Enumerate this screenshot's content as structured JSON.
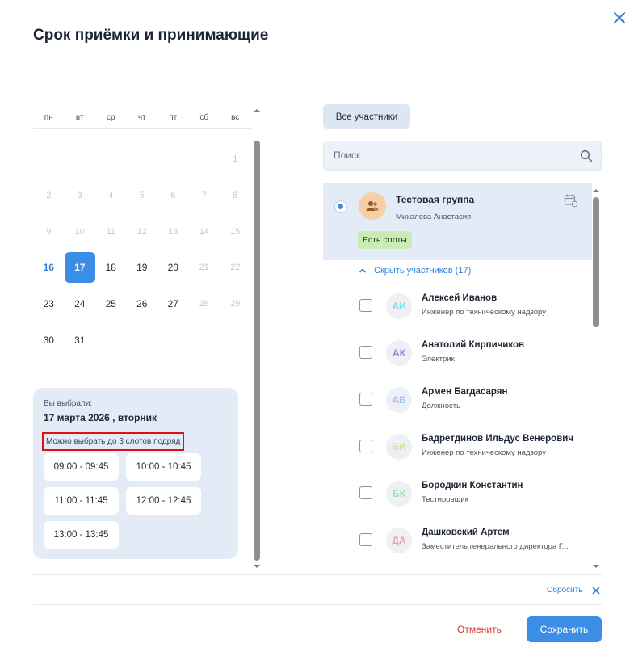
{
  "dialog": {
    "title": "Срок приёмки и принимающие"
  },
  "calendar": {
    "weekdays": [
      "пн",
      "вт",
      "ср",
      "чт",
      "пт",
      "сб",
      "вс"
    ],
    "weeks": [
      [
        {
          "d": ""
        },
        {
          "d": ""
        },
        {
          "d": ""
        },
        {
          "d": ""
        },
        {
          "d": ""
        },
        {
          "d": ""
        },
        {
          "d": "1",
          "s": "disabled"
        }
      ],
      [
        {
          "d": "2",
          "s": "disabled"
        },
        {
          "d": "3",
          "s": "disabled"
        },
        {
          "d": "4",
          "s": "disabled"
        },
        {
          "d": "5",
          "s": "disabled"
        },
        {
          "d": "6",
          "s": "disabled"
        },
        {
          "d": "7",
          "s": "disabled"
        },
        {
          "d": "8",
          "s": "disabled"
        }
      ],
      [
        {
          "d": "9",
          "s": "disabled"
        },
        {
          "d": "10",
          "s": "disabled"
        },
        {
          "d": "11",
          "s": "disabled"
        },
        {
          "d": "12",
          "s": "disabled"
        },
        {
          "d": "13",
          "s": "disabled"
        },
        {
          "d": "14",
          "s": "disabled"
        },
        {
          "d": "15",
          "s": "disabled"
        }
      ],
      [
        {
          "d": "16",
          "s": "today"
        },
        {
          "d": "17",
          "s": "selected"
        },
        {
          "d": "18"
        },
        {
          "d": "19"
        },
        {
          "d": "20"
        },
        {
          "d": "21",
          "s": "disabled"
        },
        {
          "d": "22",
          "s": "disabled"
        }
      ],
      [
        {
          "d": "23"
        },
        {
          "d": "24"
        },
        {
          "d": "25"
        },
        {
          "d": "26"
        },
        {
          "d": "27"
        },
        {
          "d": "28",
          "s": "disabled"
        },
        {
          "d": "29",
          "s": "disabled"
        }
      ],
      [
        {
          "d": "30"
        },
        {
          "d": "31"
        },
        {
          "d": ""
        },
        {
          "d": ""
        },
        {
          "d": ""
        },
        {
          "d": ""
        },
        {
          "d": ""
        }
      ]
    ]
  },
  "selection": {
    "label": "Вы выбрали:",
    "date": "17 марта 2026 , вторник",
    "hint": "Можно выбрать до 3 слотов подряд",
    "slots": [
      "09:00 - 09:45",
      "10:00 - 10:45",
      "11:00 - 11:45",
      "12:00 - 12:45",
      "13:00 - 13:45"
    ]
  },
  "participants": {
    "tab_all": "Все участники",
    "search_placeholder": "Поиск",
    "group": {
      "name": "Тестовая группа",
      "sub": "Михалева Анастасия",
      "badge": "Есть слоты"
    },
    "toggle": "Скрыть участников (17)",
    "members": [
      {
        "initials": "АИ",
        "color": "#7fe0ea",
        "name": "Алексей Иванов",
        "role": "Инженер по техническому надзору"
      },
      {
        "initials": "АК",
        "color": "#8b84e6",
        "name": "Анатолий Кирпичиков",
        "role": "Электрик"
      },
      {
        "initials": "АБ",
        "color": "#9ec3ec",
        "name": "Армен Багдасарян",
        "role": "Должность"
      },
      {
        "initials": "БИ",
        "color": "#c4ec8e",
        "name": "Бадретдинов Ильдус Венерович",
        "role": "Инженер по техническому надзору"
      },
      {
        "initials": "БК",
        "color": "#9ee6a6",
        "name": "Бородкин Константин",
        "role": "Тестировщик"
      },
      {
        "initials": "ДА",
        "color": "#f29aae",
        "name": "Дашковский Артем",
        "role": "Заместитель генерального директора Г..."
      }
    ]
  },
  "footer": {
    "reset": "Сбросить",
    "cancel": "Отменить",
    "save": "Сохранить"
  }
}
